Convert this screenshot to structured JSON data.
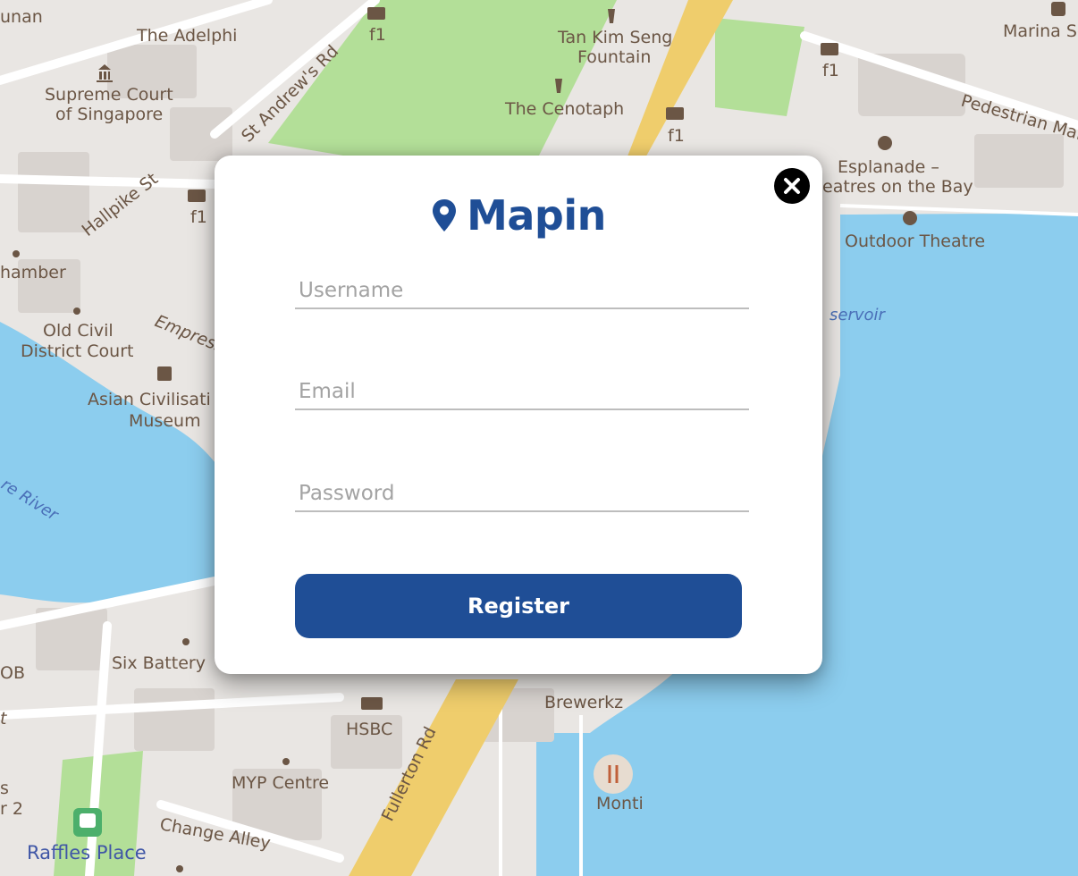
{
  "map": {
    "colors": {
      "water": "#8ccdee",
      "land": "#e9e6e3",
      "park": "#b3df98",
      "road": "#ffffff",
      "major_road": "#efcd6c",
      "label": "#6b5645"
    },
    "labels": {
      "unan": "unan",
      "the_adelphi": "The Adelphi",
      "f1_top": "f1",
      "tan_kim_seng_1": "Tan Kim Seng",
      "tan_kim_seng_2": "Fountain",
      "marina_sq": "Marina So",
      "f1_right": "f1",
      "supreme_court_1": "Supreme Court",
      "supreme_court_2": "of Singapore",
      "st_andrews_rd": "St Andrew's Rd",
      "the_cenotaph": "The Cenotaph",
      "f1_mid": "f1",
      "pedestrian_mall": "Pedestrian Mall",
      "hallpike_st": "Hallpike St",
      "f1_left": "f1",
      "esplanade_1": "Esplanade –",
      "esplanade_2": "eatres on the Bay",
      "outdoor_theatre": "Outdoor Theatre",
      "chamber": "hamber",
      "reservoir": "servoir",
      "old_civil_1": "Old Civil",
      "old_civil_2": "District Court",
      "empress": "Empress",
      "asian_civ_1": "Asian Civilisati",
      "asian_civ_2": "Museum",
      "river": "re River",
      "six_battery": "Six Battery",
      "ob": "OB",
      "t": "t",
      "brewerkz": "Brewerkz",
      "hsbc": "HSBC",
      "fullerton_rd": "Fullerton Rd",
      "monti": "Monti",
      "myp_centre": "MYP Centre",
      "s": "s",
      "r2": "r 2",
      "change_alley": "Change Alley",
      "raffles_place": "Raffles Place"
    }
  },
  "modal": {
    "brand": "Mapin",
    "brand_color": "#1f4e96",
    "icons": {
      "logo": "map-pin-icon",
      "close": "close-icon"
    },
    "fields": {
      "username_placeholder": "Username",
      "email_placeholder": "Email",
      "password_placeholder": "Password"
    },
    "register_label": "Register"
  }
}
